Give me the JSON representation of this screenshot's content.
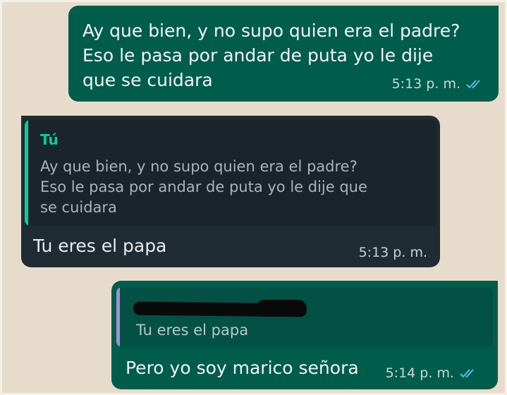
{
  "conversation": {
    "message_1": {
      "text": "Ay que bien, y no supo quien era el padre?\nEso le pasa por andar de puta yo le dije\nque se cuidara",
      "time": "5:13 p. m.",
      "status_icon": "double-check-read-icon"
    },
    "message_2": {
      "quote_author": "Tú",
      "quote_text": "Ay que bien, y no supo quien era el padre?\nEso le pasa por andar de puta yo le dije que\nse cuidara",
      "text": "Tu eres el papa",
      "time": "5:13 p. m."
    },
    "message_3": {
      "quote_text": "Tu eres el papa",
      "text": "Pero yo soy marico señora",
      "time": "5:14 p. m.",
      "status_icon": "double-check-read-icon"
    }
  },
  "colors": {
    "background": "#e7dccb",
    "outgoing_bubble": "#005c4b",
    "incoming_bubble": "#1f2c33",
    "quote_bar_self": "#06cf9c",
    "quote_bar_other": "#a290d6",
    "read_ticks": "#53bdeb"
  }
}
